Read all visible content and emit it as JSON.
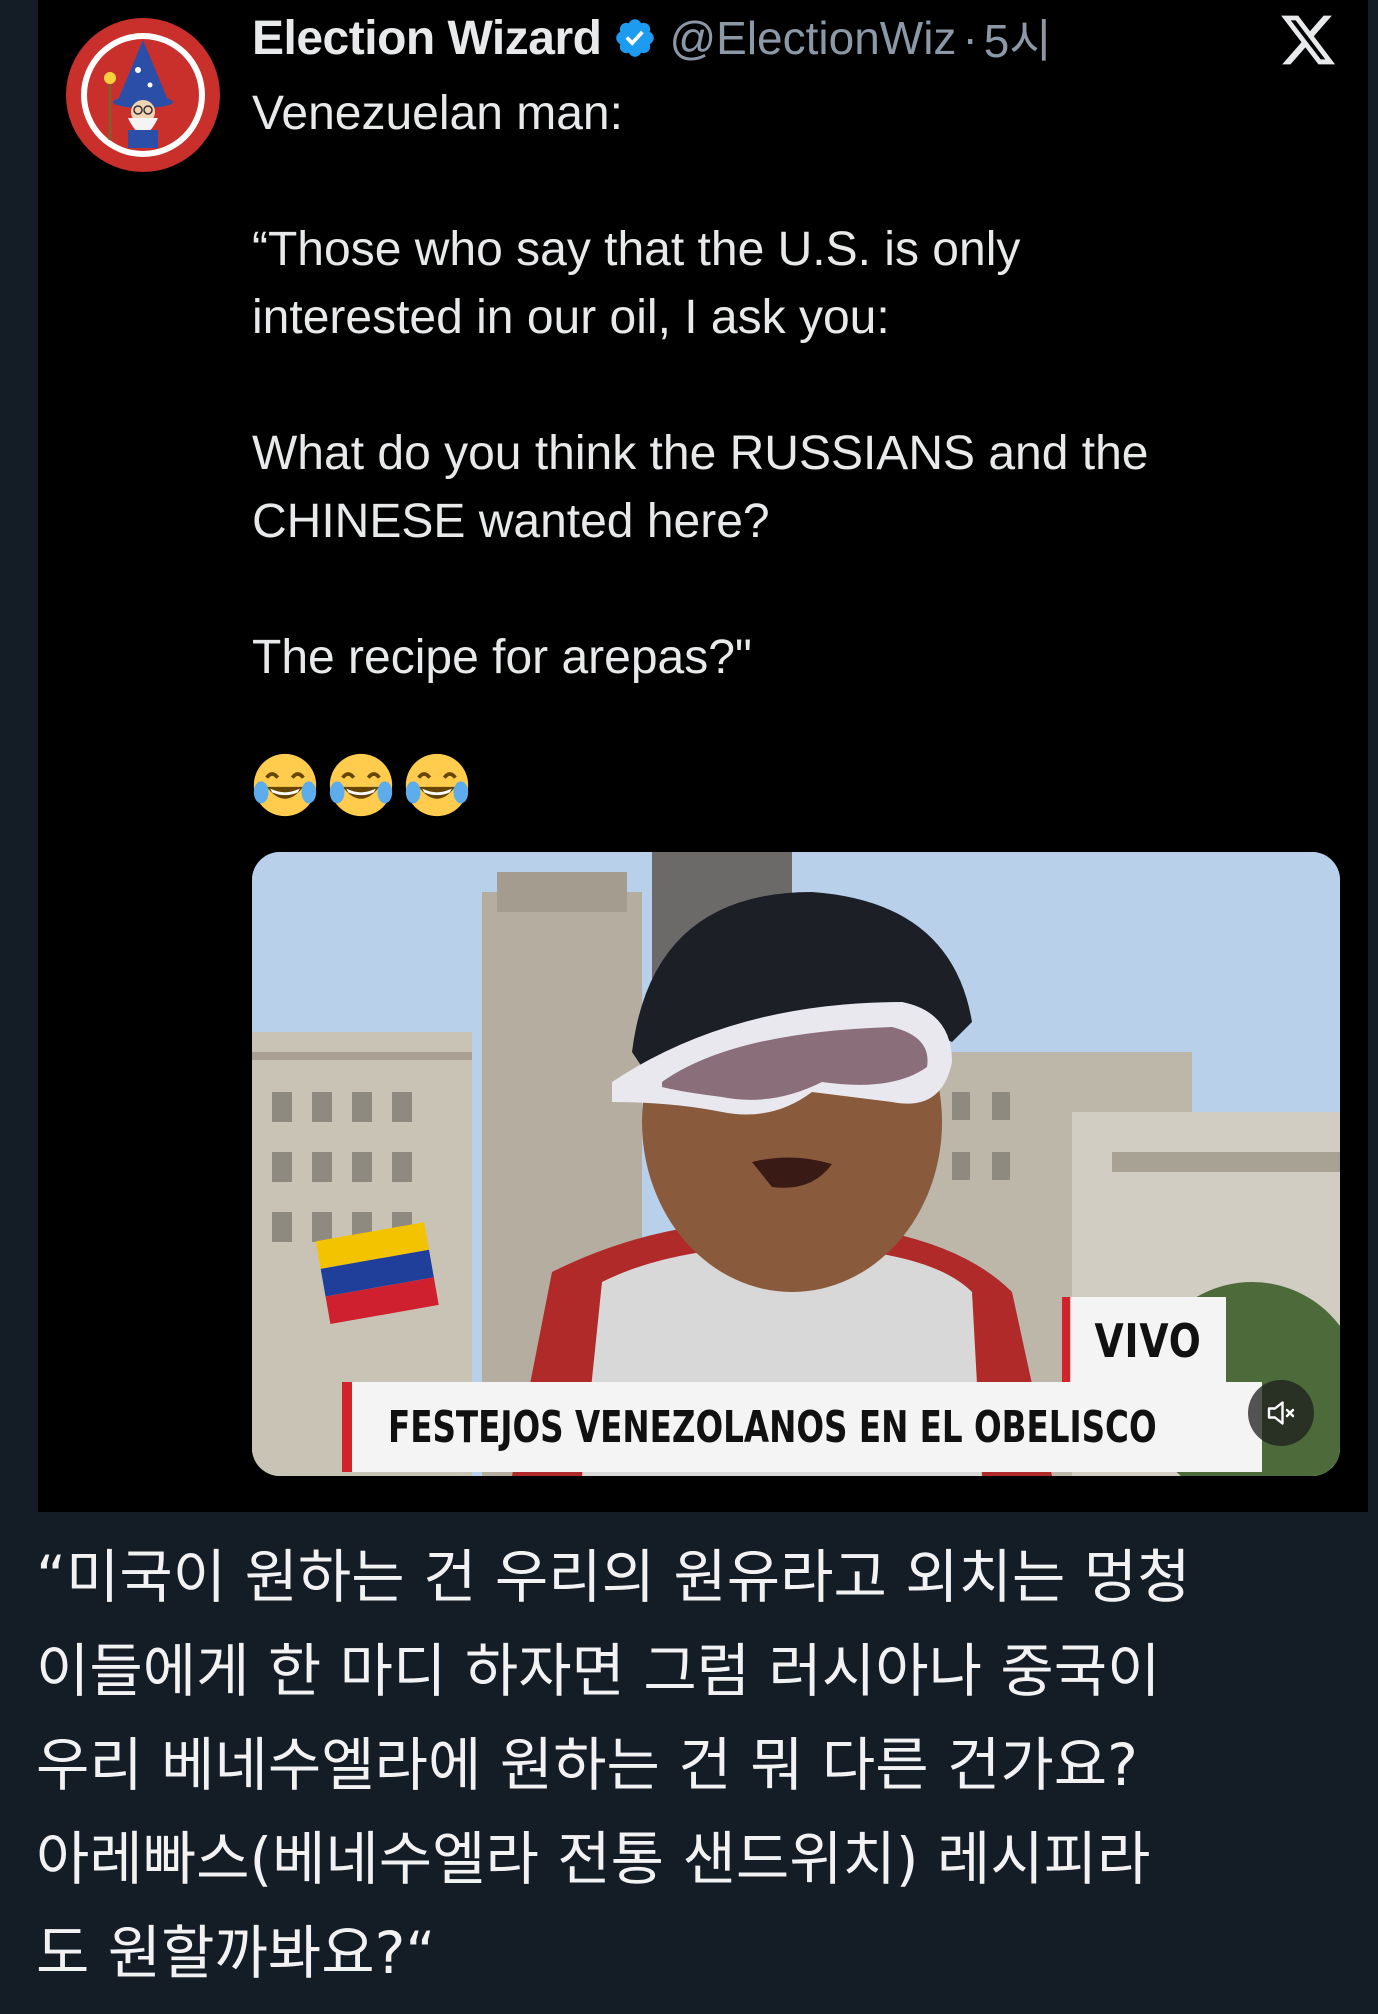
{
  "tweet": {
    "author_name": "Election Wizard",
    "handle": "@ElectionWiz",
    "separator": "·",
    "time": "5시",
    "body_lines": [
      "Venezuelan man:",
      "",
      "“Those who say that the U.S. is only",
      "interested in our oil, I ask you:",
      "",
      "What do you think the RUSSIANS and the",
      "CHINESE wanted here?",
      "",
      "The recipe for arepas?\""
    ],
    "emojis": [
      "face-with-tears-of-joy",
      "face-with-tears-of-joy",
      "face-with-tears-of-joy"
    ],
    "verified_color": "#1d9bf0",
    "video": {
      "live_tag": "VIVO",
      "chyron": "FESTEJOS VENEZOLANOS EN EL OBELISCO",
      "accent_color": "#d2232a"
    }
  },
  "caption": {
    "lines": [
      "“미국이 원하는 건 우리의 원유라고 외치는 멍청",
      "이들에게 한 마디 하자면 그럼 러시아나 중국이",
      "우리 베네수엘라에 원하는 건 뭐 다른 건가요?",
      "아레빠스(베네수엘라 전통 샌드위치) 레시피라",
      "도 원할까봐요?“"
    ]
  }
}
